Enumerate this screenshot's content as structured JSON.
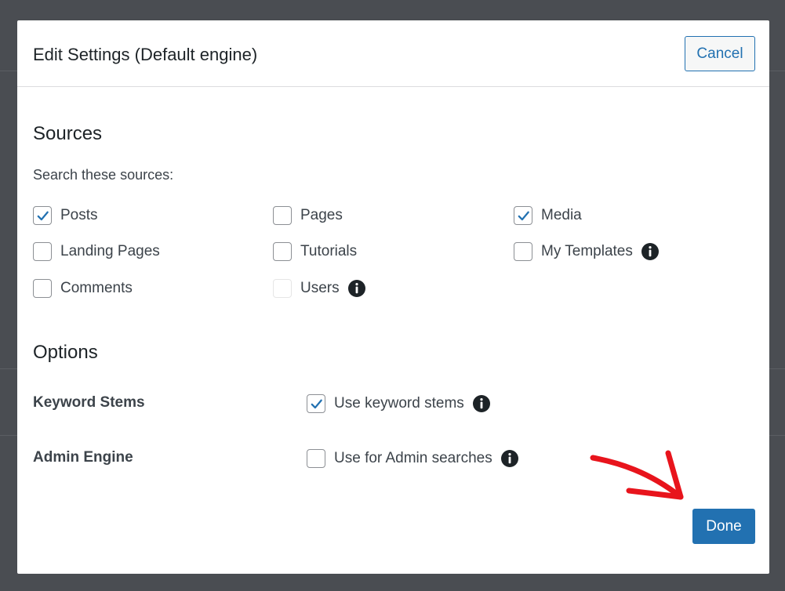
{
  "modal": {
    "title": "Edit Settings (Default engine)",
    "cancel_label": "Cancel",
    "done_label": "Done"
  },
  "sources": {
    "title": "Sources",
    "description": "Search these sources:",
    "items": [
      {
        "label": "Posts",
        "checked": true,
        "info": false,
        "disabled": false
      },
      {
        "label": "Pages",
        "checked": false,
        "info": false,
        "disabled": false
      },
      {
        "label": "Media",
        "checked": true,
        "info": false,
        "disabled": false
      },
      {
        "label": "Landing Pages",
        "checked": false,
        "info": false,
        "disabled": false
      },
      {
        "label": "Tutorials",
        "checked": false,
        "info": false,
        "disabled": false
      },
      {
        "label": "My Templates",
        "checked": false,
        "info": true,
        "disabled": false
      },
      {
        "label": "Comments",
        "checked": false,
        "info": false,
        "disabled": false
      },
      {
        "label": "Users",
        "checked": false,
        "info": true,
        "disabled": true
      }
    ]
  },
  "options": {
    "title": "Options",
    "keyword_stems": {
      "label": "Keyword Stems",
      "checkbox_label": "Use keyword stems",
      "checked": true
    },
    "admin_engine": {
      "label": "Admin Engine",
      "checkbox_label": "Use for Admin searches",
      "checked": false
    }
  },
  "colors": {
    "accent": "#2271b1",
    "annotation_arrow": "#e8141c"
  }
}
